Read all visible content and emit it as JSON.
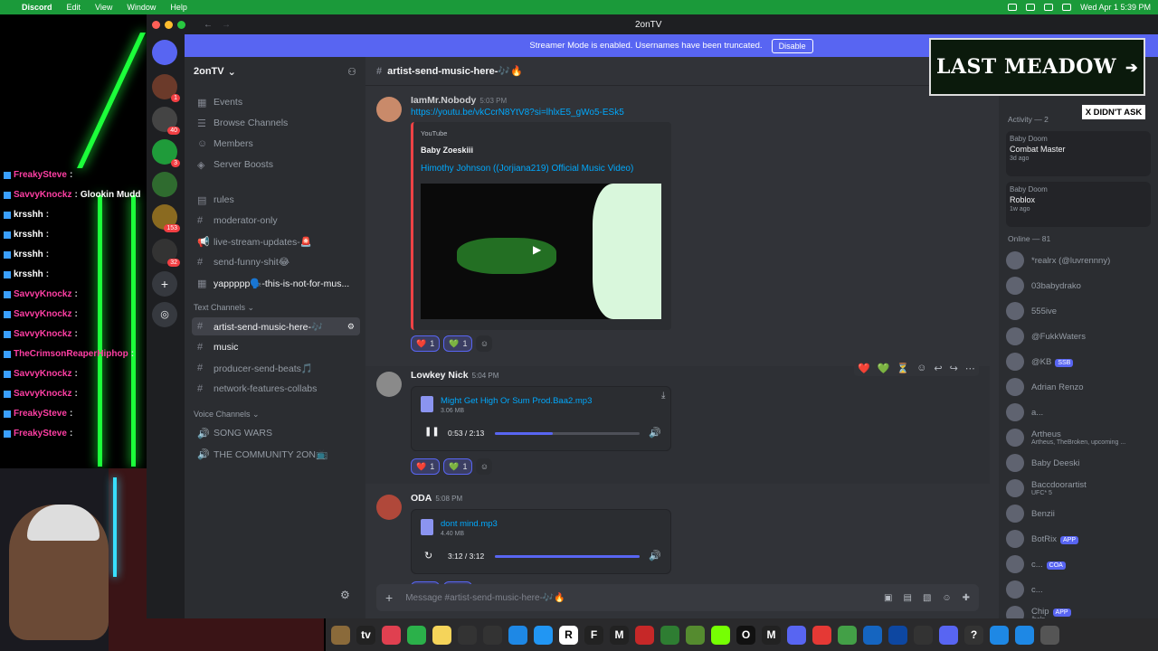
{
  "menubar": {
    "apple": "",
    "app": "Discord",
    "items": [
      "Edit",
      "View",
      "Window",
      "Help"
    ],
    "clock": "Wed Apr 1  5:39 PM"
  },
  "window": {
    "title": "2onTV"
  },
  "streamer_banner": {
    "text": "Streamer Mode is enabled. Usernames have been truncated.",
    "button": "Disable"
  },
  "server": {
    "name": "2onTV"
  },
  "guild_badges": [
    "1",
    "40",
    "3",
    "153",
    "32"
  ],
  "channels": {
    "top": [
      {
        "icon": "calendar-icon",
        "label": "Events"
      },
      {
        "icon": "browse-icon",
        "label": "Browse Channels"
      },
      {
        "icon": "members-icon",
        "label": "Members"
      },
      {
        "icon": "boost-icon",
        "label": "Server Boosts"
      }
    ],
    "list": [
      "rules",
      "moderator-only",
      "live-stream-updates-🚨",
      "send-funny-shit😂",
      "yappppp🗣️-this-is-not-for-mus..."
    ],
    "text_category": "Text Channels",
    "text": [
      "artist-send-music-here-🎶🔥",
      "music",
      "producer-send-beats🎵",
      "network-features-collabs"
    ],
    "voice_category": "Voice Channels",
    "voice": [
      "SONG WARS",
      "THE COMMUNITY 2ON📺"
    ]
  },
  "channel_header": {
    "name": "artist-send-music-here-🎶🔥"
  },
  "messages": [
    {
      "user": "IamMr.Nobody",
      "time": "5:03 PM",
      "link": "https://youtu.be/vkCcrN8YtV8?si=lhlxE5_gWo5-ESk5",
      "embed_provider": "YouTube",
      "embed_author": "Baby Zoeskiii",
      "embed_title": "Himothy Johnson ((Jorjiana219) Official Music Video)",
      "reactions": [
        {
          "emoji": "❤️",
          "count": "1"
        },
        {
          "emoji": "💚",
          "count": "1"
        }
      ]
    },
    {
      "user": "Lowkey Nick",
      "time": "5:04 PM",
      "file": "Might Get High Or Sum Prod.Baa2.mp3",
      "size": "3.06 MB",
      "playback": "0:53 / 2:13",
      "progress": 0.4,
      "reactions": [
        {
          "emoji": "❤️",
          "count": "1"
        },
        {
          "emoji": "💚",
          "count": "1"
        }
      ]
    },
    {
      "user": "ODA",
      "time": "5:08 PM",
      "file": "dont mind.mp3",
      "size": "4.40 MB",
      "playback": "3:12 / 3:12",
      "progress": 1.0,
      "reactions": [
        {
          "emoji": "❤️",
          "count": "1"
        },
        {
          "emoji": "💚",
          "count": "1"
        }
      ]
    }
  ],
  "composer": {
    "placeholder": "Message #artist-send-music-here-🎶🔥"
  },
  "members": {
    "activity_header": "Activity — 2",
    "activity": [
      {
        "user": "Baby Doom",
        "game": "Combat Master",
        "ago": "3d ago"
      },
      {
        "user": "Baby Doom",
        "game": "Roblox",
        "ago": "1w ago"
      }
    ],
    "online_header": "Online — 81",
    "list": [
      {
        "name": "*realrx (@luvrennny)",
        "tag": ""
      },
      {
        "name": "03babydrako",
        "tag": ""
      },
      {
        "name": "555ive",
        "tag": ""
      },
      {
        "name": "@FukkWaters",
        "tag": ""
      },
      {
        "name": "@KB",
        "tag": "SSB"
      },
      {
        "name": "Adrian Renzo",
        "tag": ""
      },
      {
        "name": "a...",
        "tag": ""
      },
      {
        "name": "Artheus",
        "sub": "Artheus, TheBroken, upcoming ...",
        "tag": ""
      },
      {
        "name": "Baby Deeski",
        "tag": ""
      },
      {
        "name": "Baccdoorartist",
        "sub": "UFC* 5",
        "tag": ""
      },
      {
        "name": "Benzii",
        "tag": ""
      },
      {
        "name": "BotRix",
        "tag": "APP"
      },
      {
        "name": "c...",
        "tag": "COA"
      },
      {
        "name": "c...",
        "tag": ""
      },
      {
        "name": "Chip",
        "sub": "/help",
        "tag": "APP"
      }
    ]
  },
  "ad": {
    "title": "LAST MEADOW",
    "badge": "X DIDN'T ASK"
  },
  "chat_overlay": [
    {
      "user": "FreakySteve",
      "text": "",
      "color": "#ff3fa4"
    },
    {
      "user": "SavvyKnockz",
      "text": "Glookin Mudd",
      "color": "#ff3fa4"
    },
    {
      "user": "krsshh",
      "text": "",
      "color": "#ffffff"
    },
    {
      "user": "krsshh",
      "text": "",
      "color": "#ffffff"
    },
    {
      "user": "krsshh",
      "text": "",
      "color": "#ffffff"
    },
    {
      "user": "krsshh",
      "text": "",
      "color": "#ffffff"
    },
    {
      "user": "SavvyKnockz",
      "text": "",
      "color": "#ff3fa4"
    },
    {
      "user": "SavvyKnockz",
      "text": "",
      "color": "#ff3fa4"
    },
    {
      "user": "SavvyKnockz",
      "text": "",
      "color": "#ff3fa4"
    },
    {
      "user": "TheCrimsonReaperHiphop",
      "text": "",
      "color": "#ff3fa4"
    },
    {
      "user": "SavvyKnockz",
      "text": "",
      "color": "#ff3fa4"
    },
    {
      "user": "SavvyKnockz",
      "text": "",
      "color": "#ff3fa4"
    },
    {
      "user": "FreakySteve",
      "text": "",
      "color": "#ff3fa4"
    },
    {
      "user": "FreakySteve",
      "text": "",
      "color": "#ff3fa4"
    }
  ],
  "dock_labels": [
    "tv",
    "R",
    "F",
    "M",
    "O",
    "M",
    "?"
  ]
}
